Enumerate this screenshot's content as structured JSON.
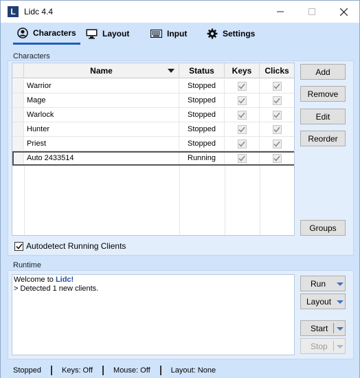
{
  "window": {
    "app_icon": "L",
    "title": "Lidc 4.4"
  },
  "tabs": [
    {
      "label": "Characters",
      "icon": "user-circle-icon",
      "active": true
    },
    {
      "label": "Layout",
      "icon": "monitor-icon",
      "active": false
    },
    {
      "label": "Input",
      "icon": "keyboard-icon",
      "active": false
    },
    {
      "label": "Settings",
      "icon": "gear-icon",
      "active": false
    }
  ],
  "characters": {
    "section_label": "Characters",
    "columns": {
      "name": "Name",
      "status": "Status",
      "keys": "Keys",
      "clicks": "Clicks"
    },
    "rows": [
      {
        "name": "Warrior",
        "status": "Stopped",
        "keys": true,
        "clicks": true
      },
      {
        "name": "Mage",
        "status": "Stopped",
        "keys": true,
        "clicks": true
      },
      {
        "name": "Warlock",
        "status": "Stopped",
        "keys": true,
        "clicks": true
      },
      {
        "name": "Hunter",
        "status": "Stopped",
        "keys": true,
        "clicks": true
      },
      {
        "name": "Priest",
        "status": "Stopped",
        "keys": true,
        "clicks": true
      },
      {
        "name": "Auto 2433514",
        "status": "Running",
        "keys": true,
        "clicks": true
      }
    ],
    "buttons": {
      "add": "Add",
      "remove": "Remove",
      "edit": "Edit",
      "reorder": "Reorder",
      "groups": "Groups"
    },
    "autodetect": {
      "label": "Autodetect Running Clients",
      "checked": true
    }
  },
  "runtime": {
    "section_label": "Runtime",
    "log": {
      "welcome_prefix": "Welcome to ",
      "welcome_app": "Lidc!",
      "line2": "> Detected 1 new clients."
    },
    "buttons": {
      "run": "Run",
      "layout": "Layout",
      "start": "Start",
      "stop": "Stop"
    }
  },
  "statusbar": {
    "state": "Stopped",
    "keys": "Keys: Off",
    "mouse": "Mouse: Off",
    "layout": "Layout: None"
  },
  "colors": {
    "accent": "#1f5cb8",
    "window_bg": "#cfe3fb",
    "panel_bg": "#e3eefc"
  }
}
